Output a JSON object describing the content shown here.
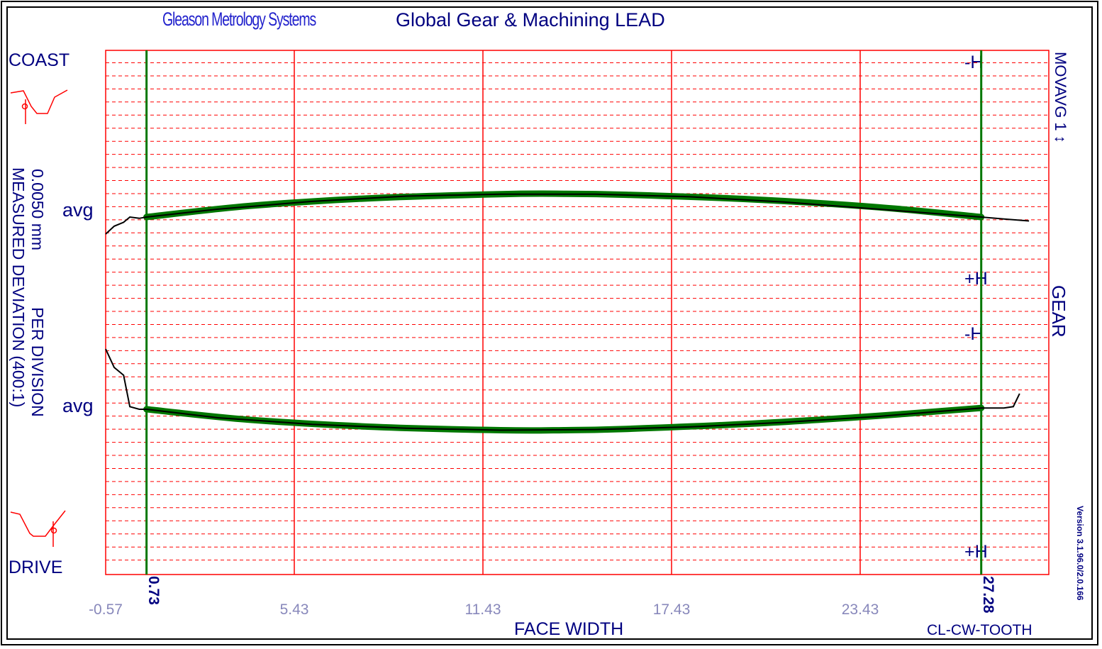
{
  "header": {
    "brand": "Gleason Metrology Systems",
    "title": "Global Gear & Machining  LEAD"
  },
  "left_panel": {
    "coast": "COAST",
    "drive": "DRIVE",
    "avg_upper": "avg",
    "avg_lower": "avg",
    "scale_line1": "0.0050 mm",
    "scale_line1b": "PER DIVISION",
    "scale_line2": "MEASURED DEVIATION (400:1)"
  },
  "right_panel": {
    "movavg": "MOVAVG 1 ↕",
    "gear": "GEAR",
    "version": "Version 3.1.96.0/2.0.166"
  },
  "markers": {
    "upper_minus": "-H",
    "upper_plus": "+H",
    "lower_minus": "-H",
    "lower_plus": "+H"
  },
  "footer": {
    "xlabel": "FACE WIDTH",
    "tooth": "CL-CW-TOOTH"
  },
  "colors": {
    "grid": "#ff0000",
    "trace": "#000000",
    "fit": "#007700",
    "label": "#000080"
  },
  "chart_data": {
    "type": "line",
    "title": "Global Gear & Machining  LEAD",
    "xlabel": "FACE WIDTH",
    "ylabel": "MEASURED DEVIATION (400:1)",
    "xlim": [
      -0.57,
      29.43
    ],
    "x_ticks": [
      "-0.57",
      "5.43",
      "11.43",
      "17.43",
      "23.43"
    ],
    "x_tick_values": [
      -0.57,
      5.43,
      11.43,
      17.43,
      23.43
    ],
    "evaluation_range": [
      "0.73",
      "27.28"
    ],
    "evaluation_range_values": [
      0.73,
      27.28
    ],
    "divisions_per_panel": 20,
    "division_value_mm": 0.005,
    "grid": true,
    "series": [
      {
        "panel": "coast",
        "kind": "measured",
        "x": [
          -0.57,
          -0.3,
          0.0,
          0.2,
          0.5,
          0.73,
          3.0,
          6.0,
          9.0,
          12.0,
          15.0,
          18.0,
          21.0,
          24.0,
          27.28,
          28.0,
          28.8
        ],
        "y": [
          -1.3,
          -0.7,
          -0.4,
          0.0,
          -0.1,
          0.0,
          0.6,
          1.2,
          1.6,
          1.75,
          1.75,
          1.55,
          1.15,
          0.6,
          0.0,
          -0.15,
          -0.3
        ]
      },
      {
        "panel": "coast",
        "kind": "fit",
        "x": [
          0.73,
          4.0,
          8.0,
          12.0,
          14.0,
          16.0,
          20.0,
          24.0,
          27.28
        ],
        "y": [
          0.0,
          0.85,
          1.45,
          1.75,
          1.78,
          1.7,
          1.35,
          0.75,
          0.0
        ]
      },
      {
        "panel": "drive",
        "kind": "measured",
        "x": [
          -0.57,
          -0.3,
          0.0,
          0.2,
          0.5,
          0.73,
          3.0,
          6.0,
          9.0,
          12.0,
          15.0,
          18.0,
          21.0,
          24.0,
          27.28,
          28.0,
          28.3,
          28.5
        ],
        "y": [
          4.6,
          3.2,
          2.6,
          0.2,
          0.0,
          0.0,
          -0.65,
          -1.15,
          -1.45,
          -1.6,
          -1.55,
          -1.35,
          -1.0,
          -0.55,
          0.1,
          0.1,
          0.2,
          1.2
        ]
      },
      {
        "panel": "drive",
        "kind": "fit",
        "x": [
          0.73,
          4.0,
          8.0,
          12.0,
          14.0,
          16.0,
          20.0,
          24.0,
          27.28
        ],
        "y": [
          0.0,
          -0.8,
          -1.35,
          -1.6,
          -1.6,
          -1.5,
          -1.1,
          -0.5,
          0.1
        ]
      }
    ]
  }
}
